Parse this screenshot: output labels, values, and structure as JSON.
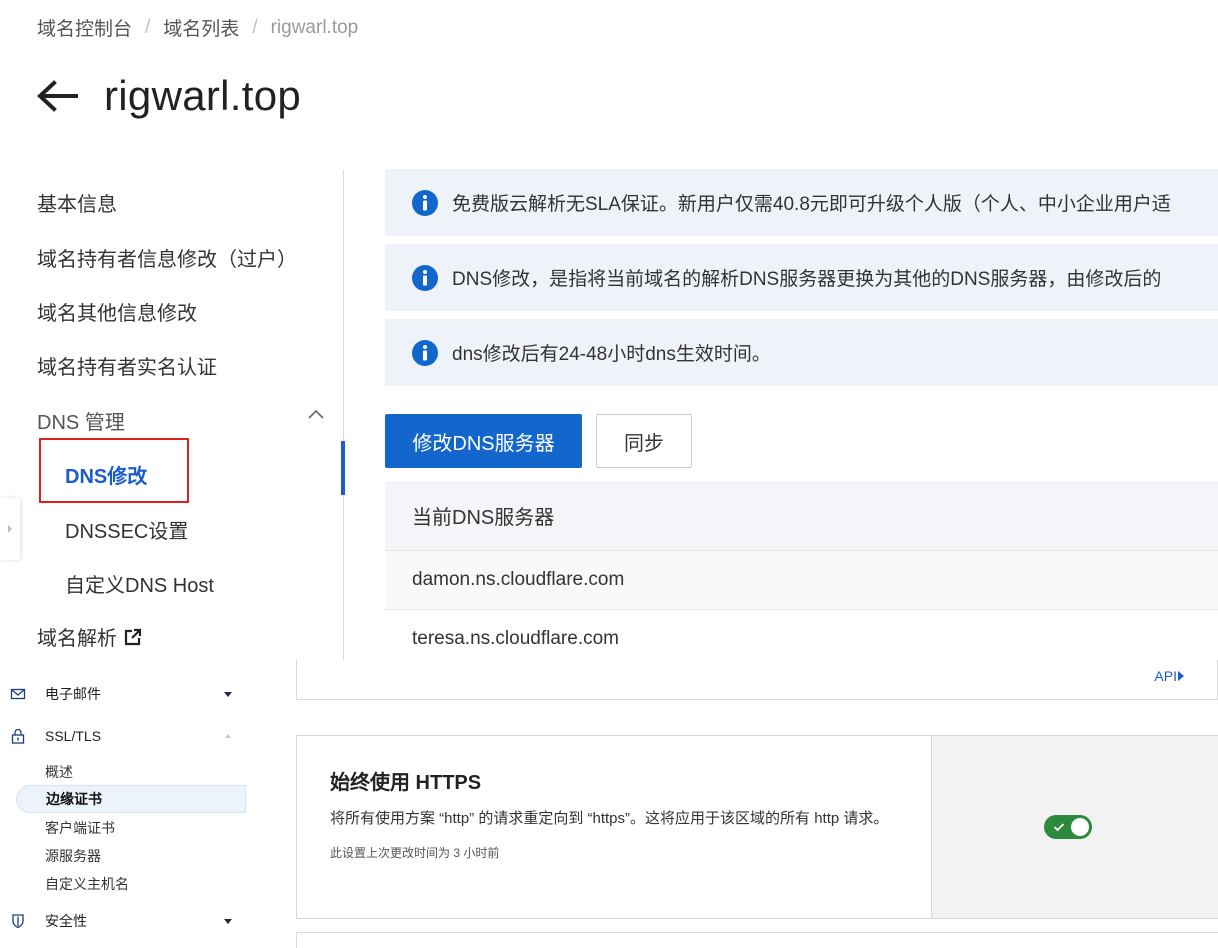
{
  "breadcrumb": {
    "items": [
      "域名控制台",
      "域名列表",
      "rigwarl.top"
    ],
    "separator": "/"
  },
  "page": {
    "title": "rigwarl.top",
    "back_icon": "arrow-left-icon"
  },
  "side_nav": {
    "items": [
      {
        "label": "基本信息"
      },
      {
        "label": "域名持有者信息修改（过户）"
      },
      {
        "label": "域名其他信息修改"
      },
      {
        "label": "域名持有者实名认证"
      }
    ],
    "dns_group": {
      "label": "DNS 管理",
      "expanded": true,
      "children": [
        {
          "label": "DNS修改",
          "active": true
        },
        {
          "label": "DNSSEC设置"
        },
        {
          "label": "自定义DNS Host"
        }
      ]
    },
    "resolve": {
      "label": "域名解析",
      "icon": "external-link-icon"
    }
  },
  "alerts": [
    {
      "icon": "info-icon",
      "text": "免费版云解析无SLA保证。新用户仅需40.8元即可升级个人版（个人、中小企业用户适"
    },
    {
      "icon": "info-icon",
      "text": "DNS修改，是指将当前域名的解析DNS服务器更换为其他的DNS服务器，由修改后的"
    },
    {
      "icon": "info-icon",
      "text": "dns修改后有24-48小时dns生效时间。"
    }
  ],
  "actions": {
    "modify_dns": "修改DNS服务器",
    "sync": "同步"
  },
  "dns_table": {
    "header": "当前DNS服务器",
    "rows": [
      "damon.ns.cloudflare.com",
      "teresa.ns.cloudflare.com"
    ]
  },
  "cf_sidebar": {
    "email": {
      "label": "电子邮件",
      "icon": "envelope-icon"
    },
    "ssl": {
      "label": "SSL/TLS",
      "icon": "lock-icon"
    },
    "ssl_children": [
      {
        "label": "概述"
      },
      {
        "label": "边缘证书",
        "active": true
      },
      {
        "label": "客户端证书"
      },
      {
        "label": "源服务器"
      },
      {
        "label": "自定义主机名"
      }
    ],
    "security": {
      "label": "安全性",
      "icon": "shield-icon"
    }
  },
  "prev_card": {
    "api_label": "API"
  },
  "https_card": {
    "title": "始终使用 HTTPS",
    "description": "将所有使用方案 “http” 的请求重定向到 “https”。这将应用于该区域的所有 http 请求。",
    "meta": "此设置上次更改时间为 3 小时前",
    "toggle_on": true
  },
  "colors": {
    "primary": "#1366cc",
    "active_nav": "#1a5cce",
    "highlight_border": "#e02020",
    "alert_bg": "#eef3fa",
    "toggle_on": "#2d8a3c"
  }
}
